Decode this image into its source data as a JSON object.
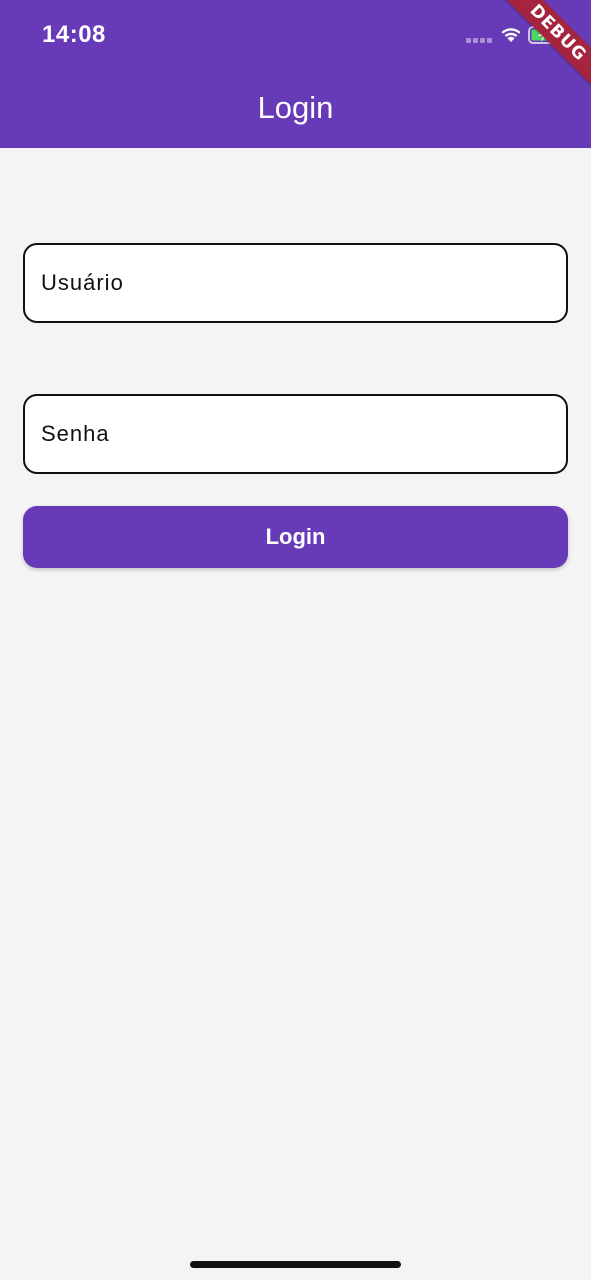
{
  "status_bar": {
    "time": "14:08"
  },
  "app_bar": {
    "title": "Login",
    "color": "#673ab7"
  },
  "debug_banner": {
    "text": "DEBUG"
  },
  "form": {
    "username_label": "Usuário",
    "password_label": "Senha",
    "login_button_label": "Login"
  },
  "icons": {
    "signal": "cellular-signal-icon",
    "wifi": "wifi-icon",
    "battery": "battery-charging-icon"
  }
}
